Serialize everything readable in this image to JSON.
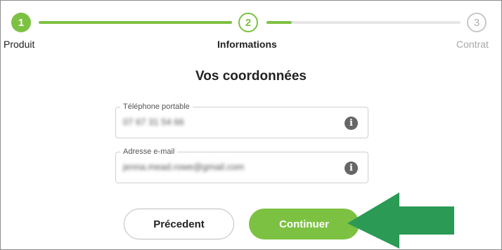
{
  "stepper": {
    "steps": [
      {
        "number": "1",
        "label": "Produit",
        "state": "done"
      },
      {
        "number": "2",
        "label": "Informations",
        "state": "current"
      },
      {
        "number": "3",
        "label": "Contrat",
        "state": "pending"
      }
    ]
  },
  "section_title": "Vos coordonnées",
  "form": {
    "phone": {
      "label": "Téléphone portable",
      "value": "07 67 31 54 66"
    },
    "email": {
      "label": "Adresse e-mail",
      "value": "jenna.mead.rowe@gmail.com"
    }
  },
  "buttons": {
    "previous_label": "Précedent",
    "continue_label": "Continuer"
  },
  "colors": {
    "accent": "#7dc142",
    "annotation_arrow": "#2a9a55"
  }
}
